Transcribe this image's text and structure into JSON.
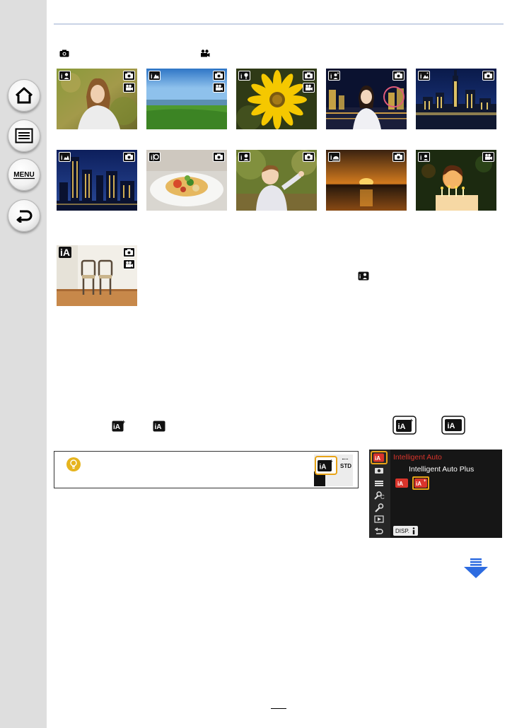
{
  "lcd": {
    "title": "Intelligent Auto",
    "subtitle": "Intelligent Auto Plus",
    "disp_label": "DISP."
  },
  "tip": {
    "mini_label": "STD"
  },
  "icons": {
    "nav": [
      "home-icon",
      "contents-icon",
      "menu-icon",
      "back-icon"
    ],
    "next_page": "next-page-arrow-icon"
  },
  "colors": {
    "rail_bg": "#dedede",
    "accent_red": "#d9342b",
    "highlight_orange": "#e8a316",
    "arrow_blue": "#2d6be0",
    "rule": "#c9d3e6"
  }
}
